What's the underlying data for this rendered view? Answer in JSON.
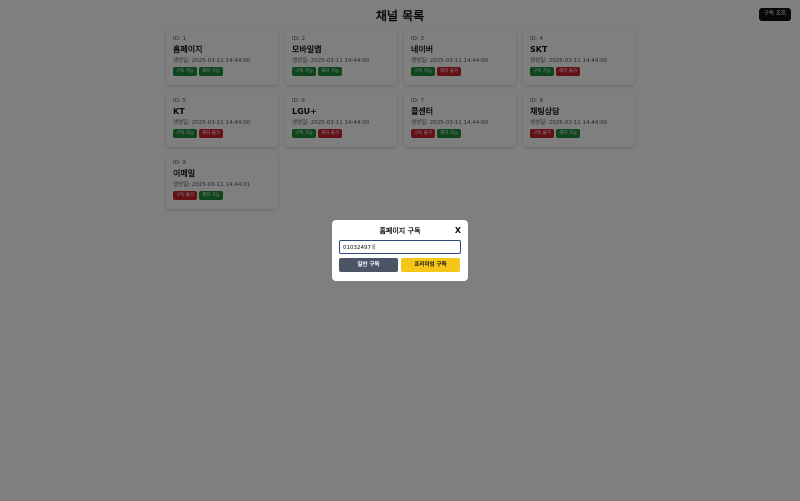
{
  "header": {
    "title": "채널 목록",
    "subscription_lookup_label": "구독 조회"
  },
  "channels": [
    {
      "id_label": "ID: 1",
      "name": "홈페이지",
      "created": "생성일: 2025-03-11 14:44:00",
      "badges": [
        {
          "label": "구독 가능",
          "color": "#1f8a3a"
        },
        {
          "label": "해지 가능",
          "color": "#1f8a3a"
        }
      ]
    },
    {
      "id_label": "ID: 2",
      "name": "모바일앱",
      "created": "생성일: 2025-03-11 14:44:00",
      "badges": [
        {
          "label": "구독 가능",
          "color": "#1f8a3a"
        },
        {
          "label": "해지 가능",
          "color": "#1f8a3a"
        }
      ]
    },
    {
      "id_label": "ID: 3",
      "name": "네이버",
      "created": "생성일: 2025-03-11 14:44:00",
      "badges": [
        {
          "label": "구독 가능",
          "color": "#1f8a3a"
        },
        {
          "label": "해지 불가",
          "color": "#c8232c"
        }
      ]
    },
    {
      "id_label": "ID: 4",
      "name": "SKT",
      "created": "생성일: 2025-03-11 14:44:00",
      "badges": [
        {
          "label": "구독 가능",
          "color": "#1f8a3a"
        },
        {
          "label": "해지 불가",
          "color": "#c8232c"
        }
      ]
    },
    {
      "id_label": "ID: 5",
      "name": "KT",
      "created": "생성일: 2025-03-11 14:44:00",
      "badges": [
        {
          "label": "구독 가능",
          "color": "#1f8a3a"
        },
        {
          "label": "해지 불가",
          "color": "#c8232c"
        }
      ]
    },
    {
      "id_label": "ID: 6",
      "name": "LGU+",
      "created": "생성일: 2025-03-11 14:44:00",
      "badges": [
        {
          "label": "구독 가능",
          "color": "#1f8a3a"
        },
        {
          "label": "해지 불가",
          "color": "#c8232c"
        }
      ]
    },
    {
      "id_label": "ID: 7",
      "name": "콜센터",
      "created": "생성일: 2025-03-11 14:44:00",
      "badges": [
        {
          "label": "구독 불가",
          "color": "#c8232c"
        },
        {
          "label": "해지 가능",
          "color": "#1f8a3a"
        }
      ]
    },
    {
      "id_label": "ID: 8",
      "name": "채팅상담",
      "created": "생성일: 2025-03-11 14:44:00",
      "badges": [
        {
          "label": "구독 불가",
          "color": "#c8232c"
        },
        {
          "label": "해지 가능",
          "color": "#1f8a3a"
        }
      ]
    },
    {
      "id_label": "ID: 9",
      "name": "이메일",
      "created": "생성일: 2025-03-11 14:44:01",
      "badges": [
        {
          "label": "구독 불가",
          "color": "#c8232c"
        },
        {
          "label": "해지 가능",
          "color": "#1f8a3a"
        }
      ]
    }
  ],
  "modal": {
    "title": "홈페이지 구독",
    "close_label": "X",
    "phone_value": "01032497ㅐ",
    "general_button": "일반 구독",
    "premium_button": "프리미엄 구독"
  }
}
